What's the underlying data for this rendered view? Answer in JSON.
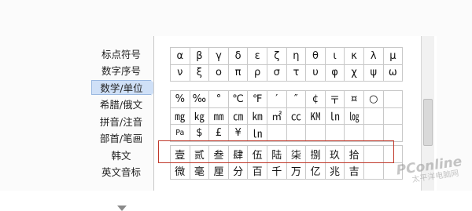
{
  "sidebar": {
    "items": [
      {
        "label": "标点符号",
        "active": false
      },
      {
        "label": "数字序号",
        "active": false
      },
      {
        "label": "数学/单位",
        "active": true
      },
      {
        "label": "希腊/俄文",
        "active": false
      },
      {
        "label": "拼音/注音",
        "active": false
      },
      {
        "label": "部首/笔画",
        "active": false
      },
      {
        "label": "韩文",
        "active": false
      },
      {
        "label": "英文音标",
        "active": false
      }
    ],
    "scroll_icon": "chevron-down-icon"
  },
  "greek_rows": [
    [
      "α",
      "β",
      "γ",
      "δ",
      "ε",
      "ζ",
      "η",
      "θ",
      "ι",
      "κ",
      "λ",
      "μ"
    ],
    [
      "ν",
      "ξ",
      "ο",
      "π",
      "ρ",
      "σ",
      "τ",
      "υ",
      "φ",
      "χ",
      "ψ",
      "ω"
    ]
  ],
  "math_rows": [
    [
      "%",
      "‰",
      "°",
      "℃",
      "℉",
      "′",
      "″",
      "¢",
      "〒",
      "¤",
      "○",
      ""
    ],
    [
      "㎎",
      "㎏",
      "㎜",
      "㎝",
      "㎞",
      "㎡",
      "㏄",
      "㏎",
      "㏑",
      "㏒",
      "",
      ""
    ],
    [
      "Pa",
      "$",
      "£",
      "¥",
      "㏑",
      "",
      "",
      "",
      "",
      "",
      "",
      ""
    ]
  ],
  "chinese_rows": [
    [
      "壹",
      "贰",
      "叁",
      "肆",
      "伍",
      "陆",
      "柒",
      "捌",
      "玖",
      "拾",
      "",
      ""
    ],
    [
      "微",
      "毫",
      "厘",
      "分",
      "百",
      "千",
      "万",
      "亿",
      "兆",
      "吉",
      "",
      ""
    ]
  ],
  "colors": {
    "active_bg": "#cfe0f7",
    "highlight_border": "#c0392b",
    "grid_border": "#c8c8c8"
  },
  "watermark": {
    "line1": "PConline",
    "line2": "太平洋电脑网"
  }
}
